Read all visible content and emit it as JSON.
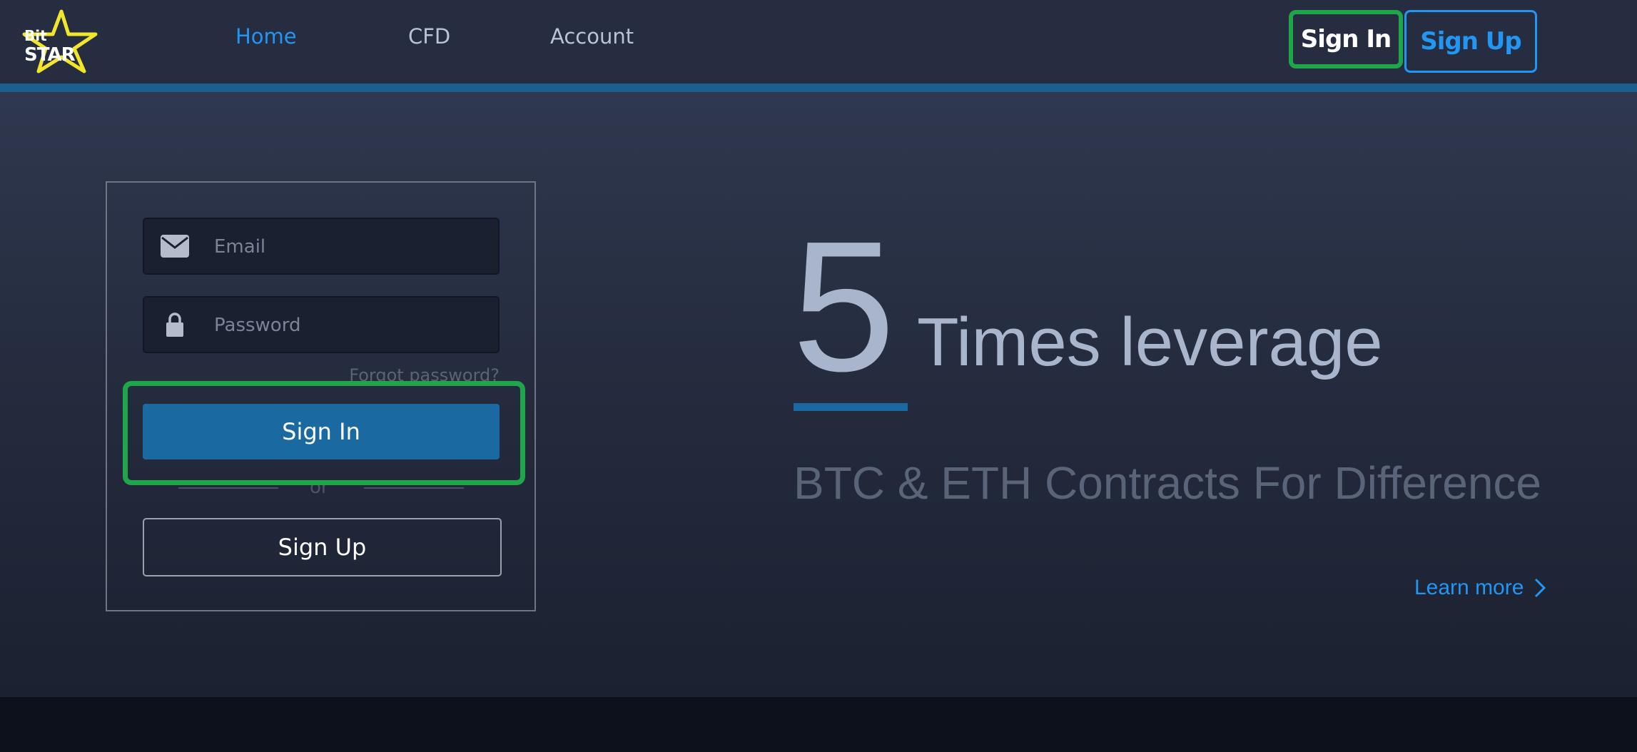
{
  "brand": {
    "logo_top": "Bit",
    "logo_bottom": "STAR"
  },
  "nav": {
    "items": [
      {
        "label": "Home",
        "active": true
      },
      {
        "label": "CFD",
        "active": false
      },
      {
        "label": "Account",
        "active": false
      }
    ],
    "sign_in_label": "Sign In",
    "sign_up_label": "Sign Up"
  },
  "login": {
    "email_placeholder": "Email",
    "password_placeholder": "Password",
    "forgot_label": "Forgot password?",
    "sign_in_label": "Sign In",
    "or_label": "or",
    "sign_up_label": "Sign Up"
  },
  "hero": {
    "leverage_number": "5",
    "leverage_text": "Times leverage",
    "subtitle": "BTC & ETH Contracts For Difference",
    "learn_more_label": "Learn more"
  },
  "icons": {
    "email": "envelope-icon",
    "password": "lock-icon",
    "learn_more": "chevron-right-icon",
    "logo": "star-icon"
  },
  "colors": {
    "accent": "#2196f3",
    "primary_button": "#1a6aa1",
    "highlight": "#1fa64a",
    "topbar": "#262d40"
  }
}
